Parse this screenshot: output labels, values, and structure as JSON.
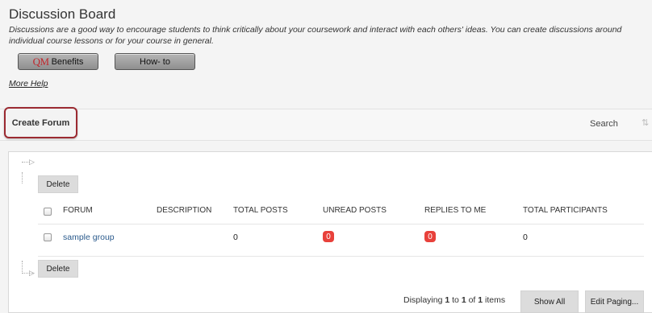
{
  "header": {
    "title": "Discussion Board",
    "description": "Discussions are a good way to encourage students to think critically about your coursework and interact with each others' ideas. You can create discussions around individual course lessons or for your course in general."
  },
  "buttons": {
    "qm_mark": "QM",
    "qm_label": "Benefits",
    "howto_label": "How- to"
  },
  "more_help": "More Help",
  "action_bar": {
    "create_forum": "Create Forum",
    "search": "Search",
    "sort_icon": "sort-icon"
  },
  "table": {
    "delete_label": "Delete",
    "columns": [
      "FORUM",
      "DESCRIPTION",
      "TOTAL POSTS",
      "UNREAD POSTS",
      "REPLIES TO ME",
      "TOTAL PARTICIPANTS"
    ],
    "rows": [
      {
        "forum": "sample group",
        "description": "",
        "total_posts": "0",
        "unread_posts": "0",
        "replies_to_me": "0",
        "total_participants": "0"
      }
    ]
  },
  "paging": {
    "prefix": "Displaying",
    "from": "1",
    "to_word": "to",
    "to": "1",
    "of_word": "of",
    "total": "1",
    "suffix": "items",
    "show_all": "Show All",
    "edit_paging": "Edit Paging..."
  },
  "colors": {
    "badge": "#e8413b",
    "highlight_border": "#9b2a31",
    "link": "#2a5a8c"
  }
}
